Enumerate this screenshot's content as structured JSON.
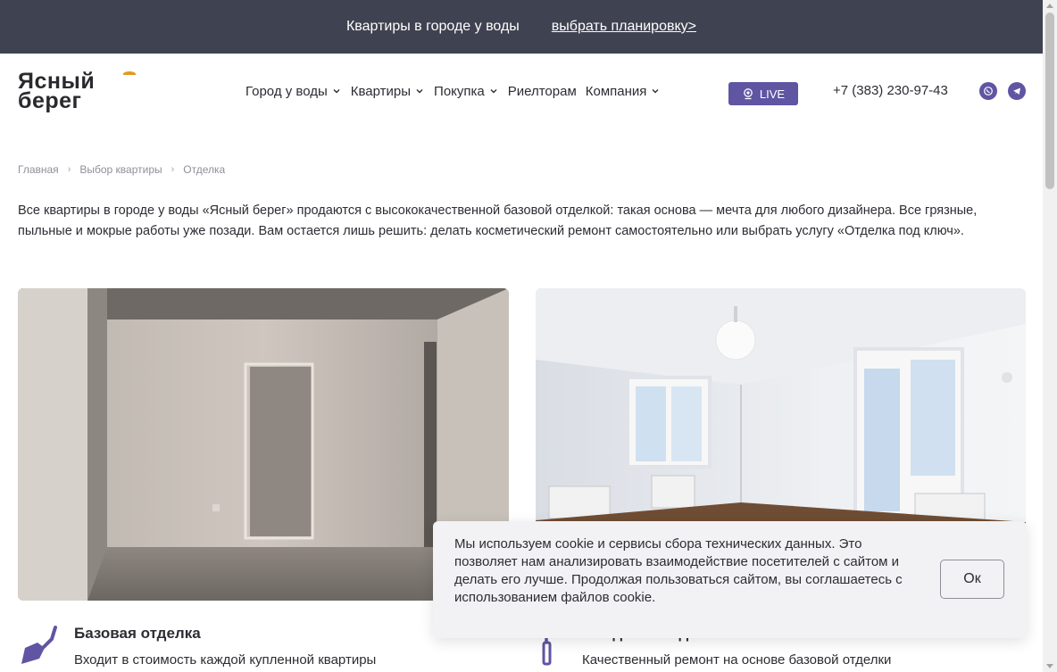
{
  "topbar": {
    "promo_text": "Квартиры в городе у воды",
    "promo_link": "выбрать планировку>"
  },
  "header": {
    "logo_line1": "Ясный",
    "logo_line2": "берег",
    "nav": [
      {
        "label": "Город у воды",
        "has_dropdown": true
      },
      {
        "label": "Квартиры",
        "has_dropdown": true
      },
      {
        "label": "Покупка",
        "has_dropdown": true
      },
      {
        "label": "Риелторам",
        "has_dropdown": false
      },
      {
        "label": "Компания",
        "has_dropdown": true
      }
    ],
    "live_label": "LIVE",
    "phone": "+7 (383) 230-97-43",
    "icons": {
      "whatsapp": "whatsapp-icon",
      "telegram": "telegram-icon",
      "live": "webcam-icon"
    }
  },
  "breadcrumb": [
    "Главная",
    "Выбор квартиры",
    "Отделка"
  ],
  "intro": "Все квартиры в городе у воды «Ясный берег» продаются с высококачественной базовой отделкой: такая основа — мечта для любого дизайнера. Все грязные, пыльные и мокрые работы уже позади. Вам остается лишь решить: делать косметический ремонт самостоятельно или выбрать услугу «Отделка под ключ».",
  "features": [
    {
      "title": "Базовая отделка",
      "desc": "Входит в стоимость каждой купленной квартиры",
      "icon": "trowel-icon"
    },
    {
      "title": "Отделка под ключ",
      "desc": "Качественный ремонт на основе базовой отделки",
      "icon": "paint-roller-icon"
    }
  ],
  "cookie": {
    "text": "Мы используем cookie и сервисы сбора технических данных. Это позволяет нам анализировать взаимодействие посетителей с сайтом и делать его лучше. Продолжая пользоваться сайтом, вы соглашаетесь с использованием файлов cookie.",
    "ok_label": "Ок"
  },
  "colors": {
    "accent": "#5f55a3",
    "topbar": "#3f4250",
    "logo_accent": "#e29a1d"
  }
}
